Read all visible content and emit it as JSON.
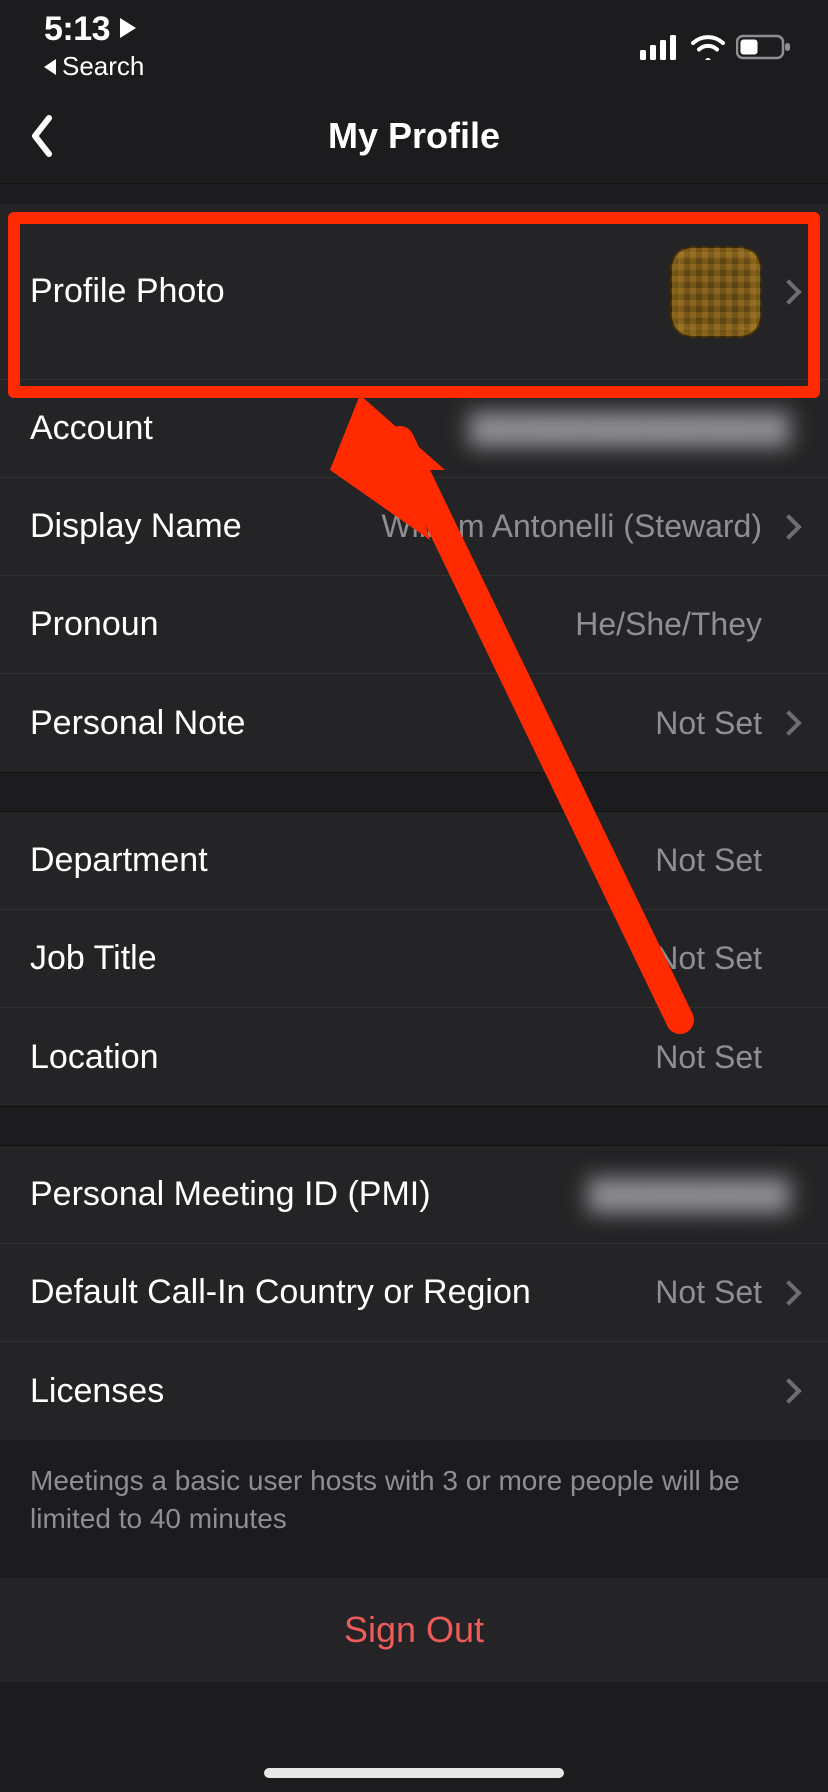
{
  "status": {
    "time": "5:13",
    "back_label": "Search"
  },
  "header": {
    "title": "My Profile"
  },
  "rows": {
    "profile_photo": {
      "label": "Profile Photo"
    },
    "account": {
      "label": "Account"
    },
    "display_name": {
      "label": "Display Name",
      "value": "William Antonelli (Steward)"
    },
    "pronoun": {
      "label": "Pronoun",
      "value": "He/She/They"
    },
    "personal_note": {
      "label": "Personal Note",
      "value": "Not Set"
    },
    "department": {
      "label": "Department",
      "value": "Not Set"
    },
    "job_title": {
      "label": "Job Title",
      "value": "Not Set"
    },
    "location": {
      "label": "Location",
      "value": "Not Set"
    },
    "pmi": {
      "label": "Personal Meeting ID (PMI)"
    },
    "default_call_in": {
      "label": "Default Call-In Country or Region",
      "value": "Not Set"
    },
    "licenses": {
      "label": "Licenses"
    }
  },
  "footer_note": "Meetings a basic user hosts with 3 or more people will be limited to 40 minutes",
  "sign_out": "Sign Out",
  "annotation_arrow": {
    "color": "#ff2a00"
  }
}
